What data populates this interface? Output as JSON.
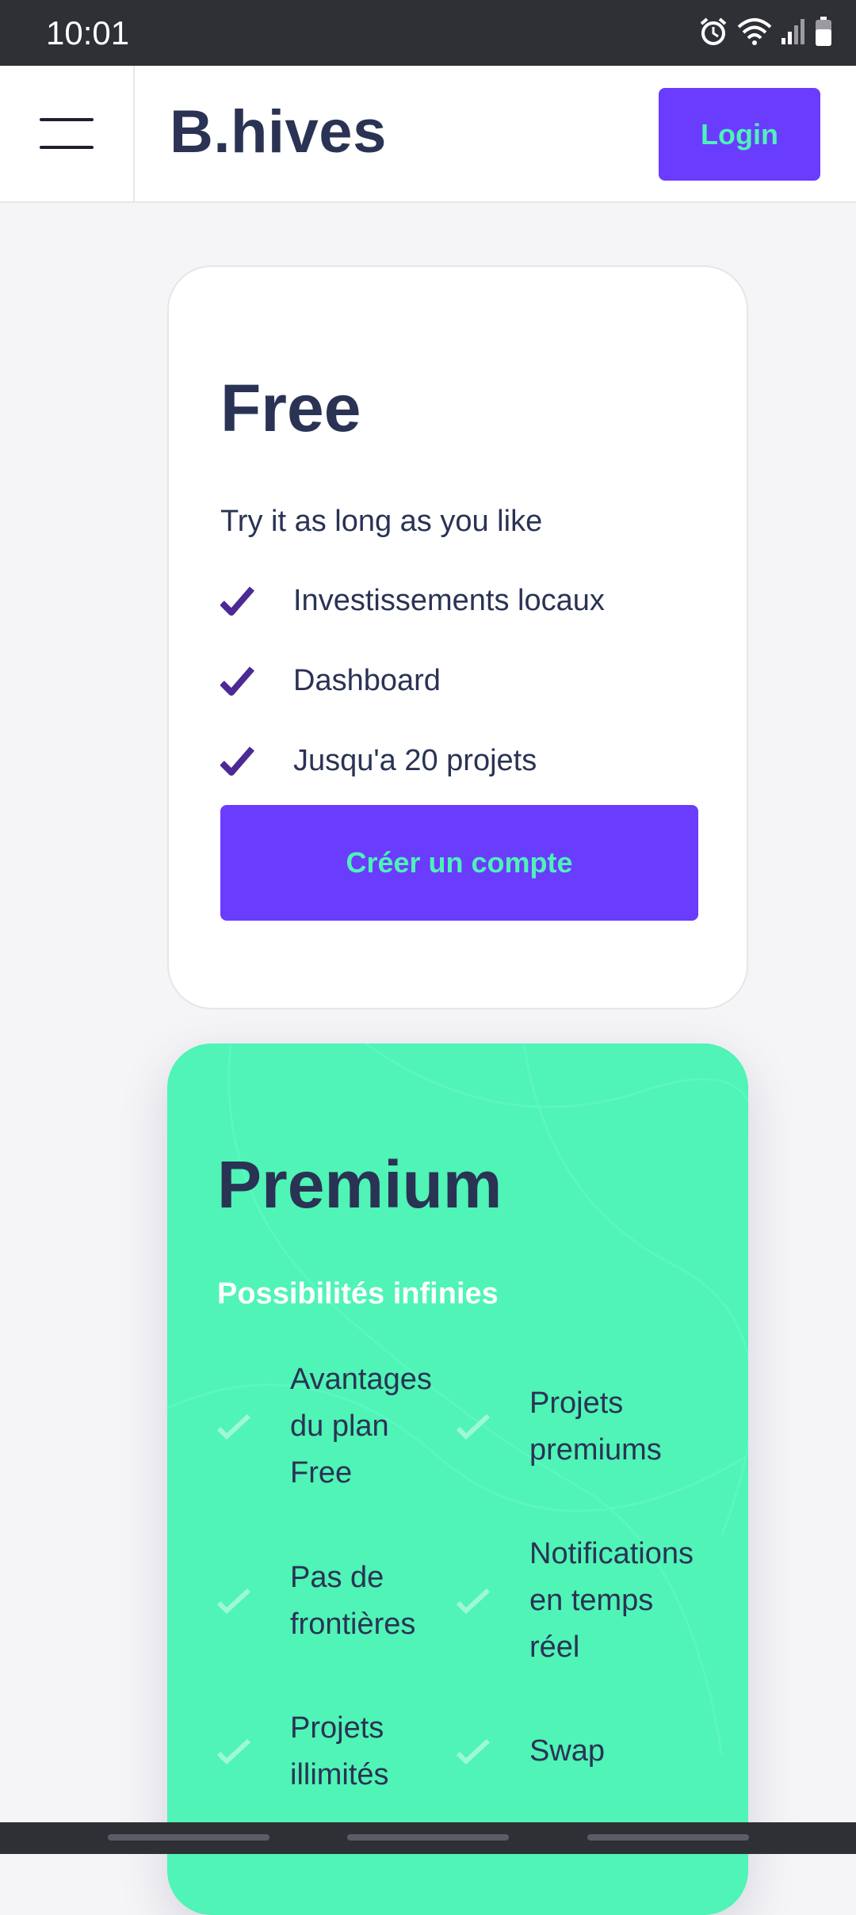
{
  "status": {
    "time": "10:01"
  },
  "header": {
    "brand": "B.hives",
    "login_label": "Login"
  },
  "free_plan": {
    "title": "Free",
    "subtitle": "Try it as long as you like",
    "features": [
      "Investissements locaux",
      "Dashboard",
      "Jusqu'a 20 projets"
    ],
    "cta_label": "Créer un compte"
  },
  "premium_plan": {
    "title": "Premium",
    "subtitle": "Possibilités infinies",
    "features": [
      [
        "Avantages",
        "du plan",
        "Free"
      ],
      [
        "Projets",
        "premiums"
      ],
      [
        "Pas de",
        "frontières"
      ],
      [
        "Notifications",
        "en temps",
        "réel"
      ],
      [
        "Projets",
        "illimités"
      ],
      [
        "Swap"
      ]
    ]
  },
  "colors": {
    "accent": "#6a3cfd",
    "mint": "#4ff4b6",
    "text": "#2a3354"
  }
}
